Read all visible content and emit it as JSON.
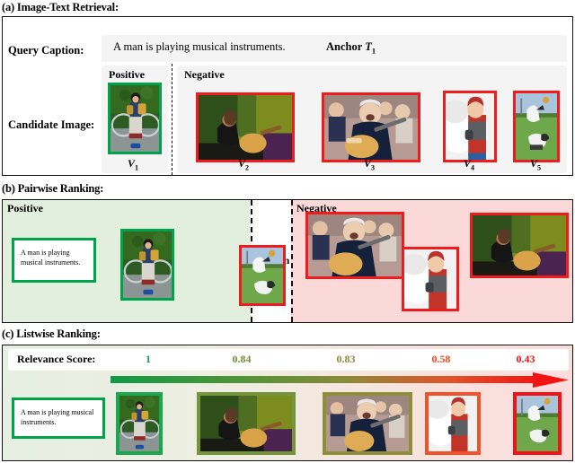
{
  "figure": {
    "sections": [
      {
        "id": "a",
        "title": "(a) Image-Text Retrieval:"
      },
      {
        "id": "b",
        "title": "(b) Pairwise Ranking:"
      },
      {
        "id": "c",
        "title": "(c) Listwise Ranking:"
      }
    ]
  },
  "panel_a": {
    "query_label": "Query Caption:",
    "candidate_label": "Candidate Image:",
    "caption_text": "A man is playing musical instruments.",
    "anchor_prefix": "Anchor ",
    "anchor_symbol": "T",
    "anchor_sub": "1",
    "positive_header": "Positive",
    "negative_header": "Negative",
    "items": [
      {
        "id": "V1",
        "sub": "1",
        "polarity": "positive",
        "border_color": "#00a24a",
        "scene": "boy-bicycle-accordion"
      },
      {
        "id": "V2",
        "sub": "2",
        "polarity": "negative",
        "border_color": "#ee1c1c",
        "scene": "woman-guitar-green"
      },
      {
        "id": "V3",
        "sub": "3",
        "polarity": "negative",
        "border_color": "#ee1c1c",
        "scene": "man-guitar-crowd"
      },
      {
        "id": "V4",
        "sub": "4",
        "polarity": "negative",
        "border_color": "#ee1c1c",
        "scene": "child-snow-red"
      },
      {
        "id": "V5",
        "sub": "5",
        "polarity": "negative",
        "border_color": "#ee1c1c",
        "scene": "dogs-field"
      }
    ]
  },
  "panel_b": {
    "positive_header": "Positive",
    "negative_header": "Negative",
    "margin_label": "Margin",
    "caption_text": "A man is playing musical instruments.",
    "positive_bg": "#e2efdc",
    "negative_bg": "#fbd9d9",
    "positive_items": [
      {
        "scene": "boy-bicycle-accordion",
        "border_color": "#00a24a"
      }
    ],
    "negative_items": [
      {
        "scene": "dogs-field",
        "border_color": "#ee1c1c"
      },
      {
        "scene": "man-guitar-crowd",
        "border_color": "#ee1c1c"
      },
      {
        "scene": "child-snow-red",
        "border_color": "#ee1c1c"
      },
      {
        "scene": "woman-guitar-green",
        "border_color": "#ee1c1c"
      }
    ]
  },
  "panel_c": {
    "score_label": "Relevance Score:",
    "caption_text": "A man is playing musical instruments.",
    "arrow_gradient_from": "#00a24a",
    "arrow_gradient_to": "#ee1c1c",
    "items": [
      {
        "score": "1",
        "score_color": "#14a04a",
        "scene": "boy-bicycle-accordion",
        "border_color": "#1aa84f"
      },
      {
        "score": "0.84",
        "score_color": "#6f9136",
        "scene": "woman-guitar-green",
        "border_color": "#74953a"
      },
      {
        "score": "0.83",
        "score_color": "#8a8a38",
        "scene": "man-guitar-crowd",
        "border_color": "#8f8f3a"
      },
      {
        "score": "0.58",
        "score_color": "#f04a22",
        "scene": "child-snow-red",
        "border_color": "#f2522a"
      },
      {
        "score": "0.43",
        "score_color": "#f21414",
        "scene": "dogs-field",
        "border_color": "#f21414"
      }
    ]
  },
  "chart_data": {
    "type": "bar",
    "title": "Relevance Score",
    "categories": [
      "V1",
      "V2",
      "V3",
      "V4",
      "V5"
    ],
    "values": [
      1,
      0.84,
      0.83,
      0.58,
      0.43
    ],
    "xlabel": "",
    "ylabel": "Relevance Score",
    "ylim": [
      0,
      1
    ]
  }
}
